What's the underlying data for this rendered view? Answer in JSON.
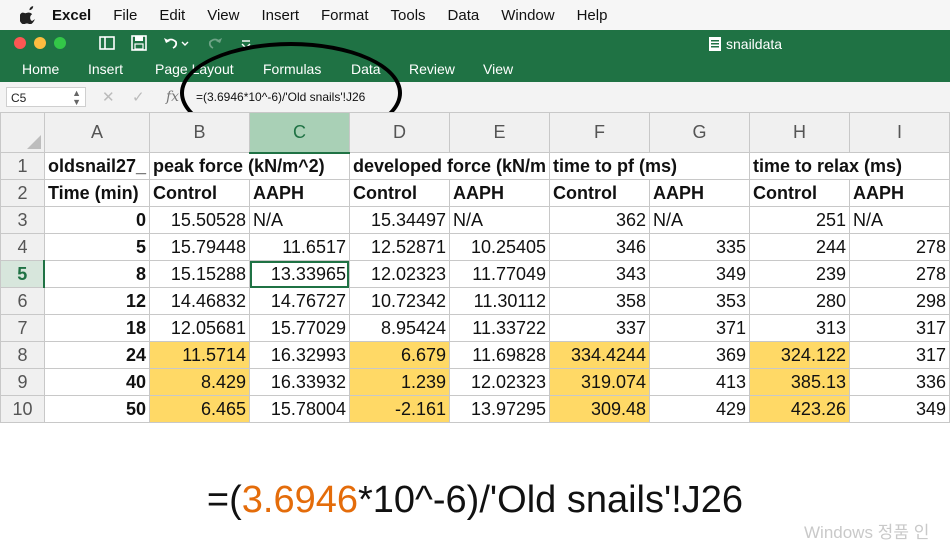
{
  "menu": {
    "app": "Excel",
    "items": [
      "File",
      "Edit",
      "View",
      "Insert",
      "Format",
      "Tools",
      "Data",
      "Window",
      "Help"
    ]
  },
  "titlebar": {
    "document": "snaildata",
    "tabs": [
      "Home",
      "Insert",
      "Page Layout",
      "Formulas",
      "Data",
      "Review",
      "View"
    ]
  },
  "formula_bar": {
    "cell_ref": "C5",
    "fx_label": "fx",
    "formula": "=(3.6946*10^-6)/'Old snails'!J26"
  },
  "sheet": {
    "columns": [
      "A",
      "B",
      "C",
      "D",
      "E",
      "F",
      "G",
      "H",
      "I"
    ],
    "active_column": "C",
    "active_row": "5",
    "rows": [
      {
        "n": "1",
        "cells": [
          "oldsnail27_",
          "peak force (kN/m^2)",
          "",
          "developed force (kN/m",
          "",
          "time to pf (ms)",
          "",
          "time to relax (ms)",
          ""
        ]
      },
      {
        "n": "2",
        "cells": [
          "Time (min)",
          "Control",
          "AAPH",
          "Control",
          "AAPH",
          "Control",
          "AAPH",
          "Control",
          "AAPH"
        ]
      },
      {
        "n": "3",
        "cells": [
          "0",
          "15.50528",
          "N/A",
          "15.34497",
          "N/A",
          "362",
          "N/A",
          "251",
          "N/A"
        ]
      },
      {
        "n": "4",
        "cells": [
          "5",
          "15.79448",
          "11.6517",
          "12.52871",
          "10.25405",
          "346",
          "335",
          "244",
          "278"
        ]
      },
      {
        "n": "5",
        "cells": [
          "8",
          "15.15288",
          "13.33965",
          "12.02323",
          "11.77049",
          "343",
          "349",
          "239",
          "278"
        ]
      },
      {
        "n": "6",
        "cells": [
          "12",
          "14.46832",
          "14.76727",
          "10.72342",
          "11.30112",
          "358",
          "353",
          "280",
          "298"
        ]
      },
      {
        "n": "7",
        "cells": [
          "18",
          "12.05681",
          "15.77029",
          "8.95424",
          "11.33722",
          "337",
          "371",
          "313",
          "317"
        ]
      },
      {
        "n": "8",
        "cells": [
          "24",
          "11.5714",
          "16.32993",
          "6.679",
          "11.69828",
          "334.4244",
          "369",
          "324.122",
          "317"
        ]
      },
      {
        "n": "9",
        "cells": [
          "40",
          "8.429",
          "16.33932",
          "1.239",
          "12.02323",
          "319.074",
          "413",
          "385.13",
          "336"
        ]
      },
      {
        "n": "10",
        "cells": [
          "50",
          "6.465",
          "15.78004",
          "-2.161",
          "13.97295",
          "309.48",
          "429",
          "423.26",
          "349"
        ]
      }
    ],
    "highlight_color": "#ffd966",
    "accent_color": "#1f7244"
  },
  "big_formula": {
    "prefix": "=(",
    "highlight": "3.6946",
    "suffix": "*10^-6)/'Old snails'!J26",
    "highlight_color": "#e46c0a"
  },
  "watermark": "Windows 정품 인"
}
